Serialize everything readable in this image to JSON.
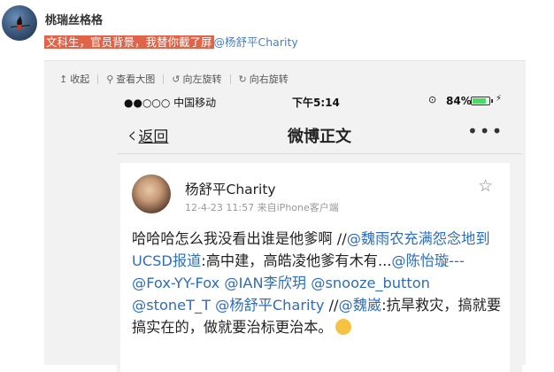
{
  "post": {
    "username": "桃瑞丝格格",
    "highlight": "文科生，官员背景，我替你截了屏",
    "mention": "@杨舒平Charity"
  },
  "toolbar": {
    "collapse": "收起",
    "view_large": "查看大图",
    "rotate_left": "向左旋转",
    "rotate_right": "向右旋转"
  },
  "phone": {
    "carrier": "●●○○○ 中国移动",
    "time": "下午5:14",
    "battery": "84%",
    "battery_level": 0.84,
    "back": "返回",
    "title": "微博正文",
    "more": "•••"
  },
  "card": {
    "name": "杨舒平Charity",
    "meta": "12-4-23 11:57  来自iPhone客户端",
    "body": [
      {
        "t": "哈哈哈怎么我没看出谁是他爹啊 //",
        "m": false
      },
      {
        "t": "@魏雨农充满怨念地到UCSD报道",
        "m": true
      },
      {
        "t": ":高中建，高皓凌他爹有木有...",
        "m": false
      },
      {
        "t": "@陈怡璇---",
        "m": true
      },
      {
        "t": " ",
        "m": false
      },
      {
        "t": "@Fox-YY-Fox",
        "m": true
      },
      {
        "t": " ",
        "m": false
      },
      {
        "t": "@IAN李欣玥",
        "m": true
      },
      {
        "t": " ",
        "m": false
      },
      {
        "t": "@snooze_button",
        "m": true
      },
      {
        "t": " ",
        "m": false
      },
      {
        "t": "@stoneT_T",
        "m": true
      },
      {
        "t": " ",
        "m": false
      },
      {
        "t": "@杨舒平Charity",
        "m": true
      },
      {
        "t": " //",
        "m": false
      },
      {
        "t": "@魏崴",
        "m": true
      },
      {
        "t": ":抗旱救灾，搞就要搞实在的，做就要治标更治本。",
        "m": false
      }
    ]
  }
}
